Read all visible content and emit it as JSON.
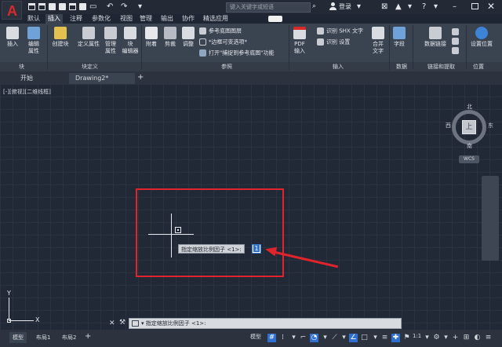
{
  "title_bar": {
    "app_letter": "A",
    "search_placeholder": "键入关键字或短语",
    "login_label": "登录"
  },
  "ribbon_tabs": [
    "默认",
    "插入",
    "注释",
    "参数化",
    "视图",
    "管理",
    "输出",
    "协作",
    "精选应用"
  ],
  "active_ribbon_tab": "插入",
  "ribbon": {
    "insert": "插入",
    "edit_attr": "编辑\n属性",
    "create_block": "创建块",
    "define_attr": "定义属性",
    "manage_attr": "管理\n属性",
    "block_editor": "块\n编辑器",
    "attach": "附着",
    "clip": "剪裁",
    "adjust": "调整",
    "ref_underlay_layers": "参考底图图层",
    "frame_variable": "*边框可变选项*",
    "snap_underlay": "打开\"捕捉到参考底图\"功能",
    "pdf_import": "PDF\n输入",
    "recognize_shx": "识别 SHX 文字",
    "recognize_settings": "识别 设置",
    "combine_text": "合并\n文字",
    "field": "字段",
    "data_link": "数据链接",
    "set_location": "设置位置",
    "groups": {
      "block": "块",
      "block_def": "块定义",
      "reference": "参照",
      "import": "输入",
      "data": "数据",
      "link_extract": "链接和提取",
      "location": "位置"
    }
  },
  "file_tabs": {
    "start": "开始",
    "drawing": "Drawing2*"
  },
  "viewport": {
    "controls_label": "[-][俯视][二维线框]",
    "viewcube": {
      "north": "北",
      "south": "南",
      "east": "东",
      "west": "西",
      "face": "上",
      "wcs": "WCS"
    },
    "dynamic_prompt": "指定缩放比例因子 <1>:",
    "dynamic_input": "1",
    "ucs_x": "X",
    "ucs_y": "Y"
  },
  "command_line": {
    "prompt": "▾ 指定缩放比例因子 <1>:"
  },
  "status_bar": {
    "tabs": [
      "模型",
      "布局1",
      "布局2"
    ],
    "model_label": "模型",
    "scale": "1:1"
  },
  "colors": {
    "accent_red": "#e0242c",
    "viewport_bg": "#212836",
    "ribbon_bg": "#3a4350"
  }
}
